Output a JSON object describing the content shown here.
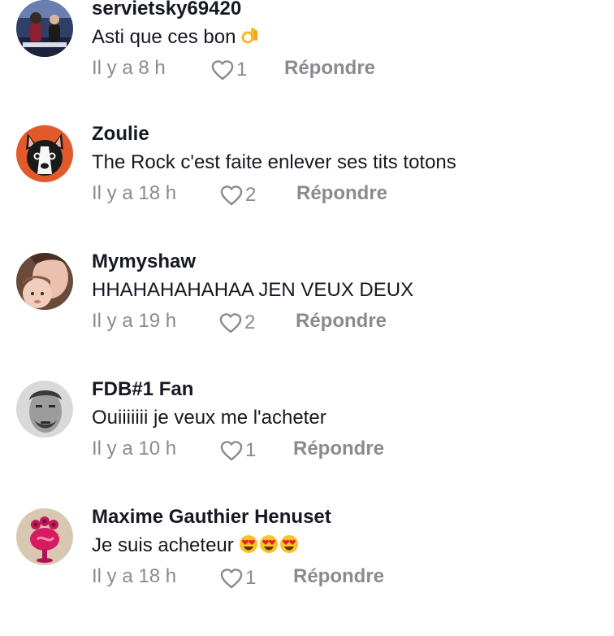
{
  "comments": [
    {
      "username": "servietsky69420",
      "text": "Asti que ces bon",
      "emoji": "ok-hand",
      "time": "Il y a 8 h",
      "likes": "1",
      "reply_label": "Répondre",
      "avatar": "tv-studio-avatar"
    },
    {
      "username": "Zoulie",
      "text": "The Rock c'est faite enlever ses tits totons",
      "time": "Il y a 18 h",
      "likes": "2",
      "reply_label": "Répondre",
      "avatar": "french-bulldog-avatar"
    },
    {
      "username": "Mymyshaw",
      "text": "HHAHAHAHAHAA JEN VEUX DEUX",
      "time": "Il y a 19 h",
      "likes": "2",
      "reply_label": "Répondre",
      "avatar": "mother-baby-avatar"
    },
    {
      "username": "FDB#1 Fan",
      "text": "Ouiiiiiii je veux me l'acheter",
      "time": "Il y a 10 h",
      "likes": "1",
      "reply_label": "Répondre",
      "avatar": "man-portrait-avatar"
    },
    {
      "username": "Maxime Gauthier Henuset",
      "text": "Je suis acheteur",
      "emoji": "heart-eyes-x3",
      "time": "Il y a 18 h",
      "likes": "1",
      "reply_label": "Répondre",
      "avatar": "pink-creature-avatar"
    }
  ],
  "colors": {
    "username": "#161823",
    "muted": "#8a8b91",
    "background": "#ffffff"
  }
}
